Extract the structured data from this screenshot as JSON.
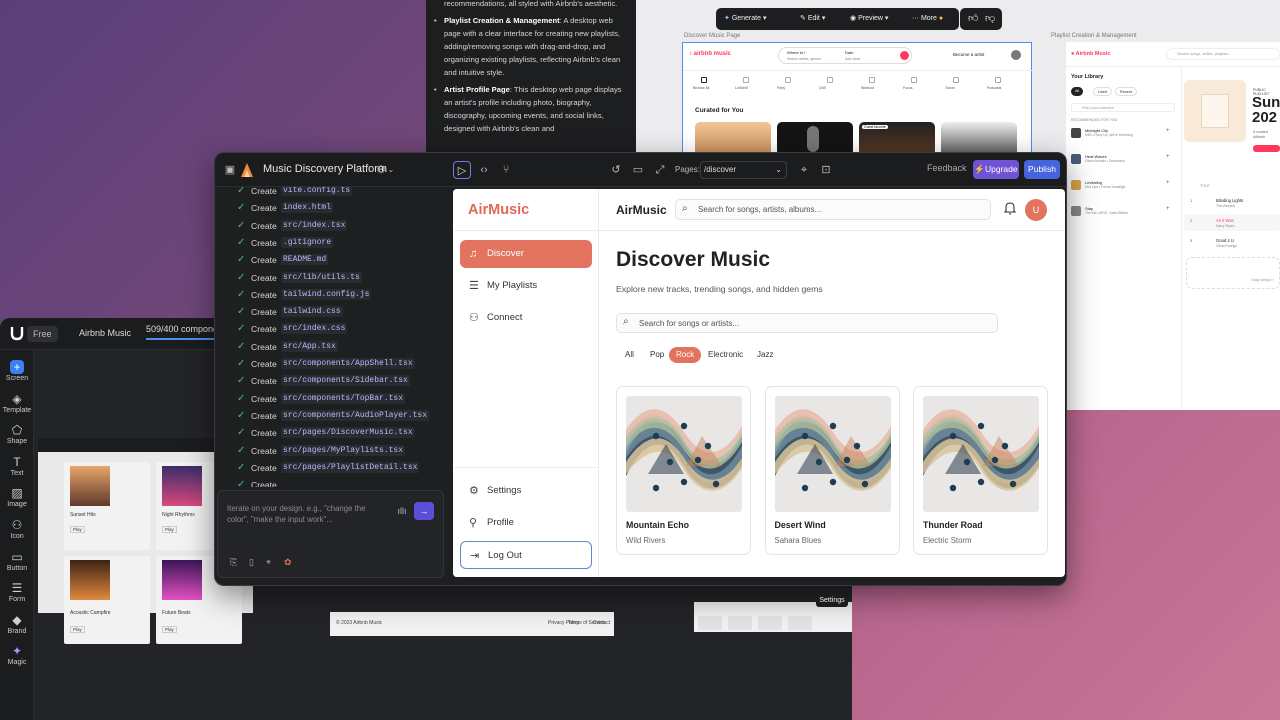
{
  "left_editor": {
    "plan_badge": "Free",
    "project_name": "Airbnb Music",
    "component_count": "509/400 components",
    "component_progress": 1.0,
    "tools": [
      {
        "label": "Screen",
        "icon": "plus-icon"
      },
      {
        "label": "Template",
        "icon": "layers-icon"
      },
      {
        "label": "Shape",
        "icon": "shape-icon"
      },
      {
        "label": "Text",
        "icon": "text-icon"
      },
      {
        "label": "Image",
        "icon": "image-icon"
      },
      {
        "label": "Icon",
        "icon": "icon-icon"
      },
      {
        "label": "Button",
        "icon": "button-icon"
      },
      {
        "label": "Form",
        "icon": "form-icon"
      },
      {
        "label": "Brand",
        "icon": "brand-icon"
      },
      {
        "label": "Magic",
        "icon": "magic-icon"
      }
    ],
    "canvas_cards": [
      {
        "title": "Sunset Hits",
        "play": "Play"
      },
      {
        "title": "Night Rhythms",
        "play": "Play"
      },
      {
        "title": "Acoustic Campfire",
        "play": "Play"
      },
      {
        "title": "Future Beats",
        "play": "Play"
      }
    ],
    "footer_copyright": "© 2023 Airbnb Music",
    "footer_links": [
      "Privacy Policy",
      "Terms of Service",
      "Contact"
    ],
    "settings_tooltip": "Settings"
  },
  "top_window": {
    "description_intro": "recommendations, all styled with Airbnb's aesthetic.",
    "description_items": [
      {
        "title": "Playlist Creation & Management",
        "text": ": A desktop web page with a clear interface for creating new playlists, adding/removing songs with drag-and-drop, and organizing existing playlists, reflecting Airbnb's clean and intuitive style."
      },
      {
        "title": "Artist Profile Page",
        "text": ": This desktop web page displays an artist's profile including photo, biography, discography, upcoming events, and social links, designed with Airbnb's clean and"
      }
    ],
    "toolbar": {
      "generate": "Generate",
      "edit": "Edit",
      "preview": "Preview",
      "more": "More"
    },
    "artboard1_label": "Discover Music Page",
    "artboard2_label": "Playlist Creation & Management",
    "artboard1": {
      "brand": "airbnb music",
      "where": "Where to?",
      "where_ph": "Search artists, genres",
      "date": "Date",
      "date_ph": "Add week",
      "become": "Become a artist",
      "categories": [
        "Browse All",
        "Lofi/chill",
        "Party",
        "Chill",
        "Workout",
        "Focus",
        "Travel",
        "Podcasts"
      ],
      "curated": "Curated for You",
      "guest_badge": "Guest favorite"
    },
    "artboard2": {
      "brand": "Airbnb Music",
      "search_ph": "Search songs, artists, playlists...",
      "library": "Your Library",
      "filters": [
        "All",
        "Liked",
        "Recent"
      ],
      "filter_collection": "Filter your collection",
      "recommended": "RECOMMENDED FOR YOU",
      "songs": [
        {
          "title": "Midnight City",
          "artist": "M83 • Hurry Up, We're Dreaming"
        },
        {
          "title": "Heat Waves",
          "artist": "Glass Animals • Dreamland"
        },
        {
          "title": "Levitating",
          "artist": "Dua Lipa • Future Nostalgia"
        },
        {
          "title": "Stay",
          "artist": "The Kid LAROI, Justin Bieber"
        }
      ],
      "public_label": "PUBLIC PLAYLIST",
      "big_title": "Sun 202",
      "created": "A curated",
      "by": "#Airbnb",
      "table_title": "TITLE",
      "tracks": [
        {
          "n": "1",
          "title": "Blinding Lights",
          "artist": "The Weeknd"
        },
        {
          "n": "2",
          "title": "As It Was",
          "artist": "Harry Styles"
        },
        {
          "n": "3",
          "title": "Good 4 U",
          "artist": "Olivia Rodrigo"
        }
      ],
      "drag": "Drag songs h"
    }
  },
  "main_window": {
    "title": "Music Discovery Platform",
    "pages_label": "Pages:",
    "pages_value": "/discover",
    "feedback": "Feedback",
    "upgrade": "Upgrade",
    "publish": "Publish",
    "files": [
      {
        "verb": "Create",
        "path": "vite.config.ts"
      },
      {
        "verb": "Create",
        "path": "index.html"
      },
      {
        "verb": "Create",
        "path": "src/index.tsx"
      },
      {
        "verb": "Create",
        "path": ".gitignore"
      },
      {
        "verb": "Create",
        "path": "README.md"
      },
      {
        "verb": "Create",
        "path": "src/lib/utils.ts"
      },
      {
        "verb": "Create",
        "path": "tailwind.config.js"
      },
      {
        "verb": "Create",
        "path": "tailwind.css"
      },
      {
        "verb": "Create",
        "path": "src/index.css"
      },
      {
        "verb": "Create",
        "path": "src/App.tsx"
      },
      {
        "verb": "Create",
        "path": "src/components/AppShell.tsx"
      },
      {
        "verb": "Create",
        "path": "src/components/Sidebar.tsx"
      },
      {
        "verb": "Create",
        "path": "src/components/TopBar.tsx"
      },
      {
        "verb": "Create",
        "path": "src/components/AudioPlayer.tsx"
      },
      {
        "verb": "Create",
        "path": "src/pages/DiscoverMusic.tsx"
      },
      {
        "verb": "Create",
        "path": "src/pages/MyPlaylists.tsx"
      },
      {
        "verb": "Create",
        "path": "src/pages/PlaylistDetail.tsx"
      },
      {
        "verb": "Create",
        "path": ""
      }
    ],
    "chat_placeholder": "Iterate on your design. e.g., \"change the color\", \"make the input work\"..."
  },
  "app": {
    "brand": "AirMusic",
    "nav": [
      {
        "label": "Discover",
        "icon": "music-note-icon",
        "active": true
      },
      {
        "label": "My Playlists",
        "icon": "list-icon",
        "active": false
      },
      {
        "label": "Connect",
        "icon": "users-icon",
        "active": false
      }
    ],
    "nav_bottom": [
      {
        "label": "Settings",
        "icon": "gear-icon"
      },
      {
        "label": "Profile",
        "icon": "user-icon"
      },
      {
        "label": "Log Out",
        "icon": "logout-icon"
      }
    ],
    "header_brand": "AirMusic",
    "header_search_placeholder": "Search for songs, artists, albums...",
    "avatar_initial": "U",
    "title": "Discover Music",
    "subtitle": "Explore new tracks, trending songs, and hidden gems",
    "search_placeholder": "Search for songs or artists...",
    "genres": [
      "All",
      "Pop",
      "Rock",
      "Electronic",
      "Jazz"
    ],
    "active_genre": "Rock",
    "cards": [
      {
        "title": "Mountain Echo",
        "artist": "Wild Rivers"
      },
      {
        "title": "Desert Wind",
        "artist": "Sahara Blues"
      },
      {
        "title": "Thunder Road",
        "artist": "Electric Storm"
      }
    ],
    "accent": "#e2735f"
  }
}
